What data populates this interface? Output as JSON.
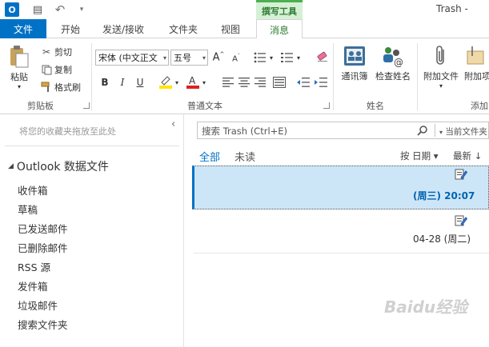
{
  "window": {
    "title": "Trash -",
    "context_tab_group": "撰写工具"
  },
  "tabs": [
    {
      "label": "文件"
    },
    {
      "label": "开始"
    },
    {
      "label": "发送/接收"
    },
    {
      "label": "文件夹"
    },
    {
      "label": "视图"
    },
    {
      "label": "消息"
    }
  ],
  "ribbon": {
    "clipboard": {
      "label": "剪贴板",
      "paste": "粘贴",
      "cut": "剪切",
      "copy": "复制",
      "format_painter": "格式刷"
    },
    "basic_text": {
      "label": "普通文本",
      "font": "宋体 (中文正文",
      "size": "五号"
    },
    "names": {
      "label": "姓名",
      "address_book": "通讯簿",
      "check_names": "检查姓名"
    },
    "include": {
      "label": "添加",
      "attach_file": "附加文件",
      "attach_item": "附加项"
    }
  },
  "left_pane": {
    "favorites_hint": "将您的收藏夹拖放至此处",
    "data_file": "Outlook 数据文件",
    "folders": [
      "收件箱",
      "草稿",
      "已发送邮件",
      "已删除邮件",
      "RSS 源",
      "发件箱",
      "垃圾邮件",
      "搜索文件夹"
    ]
  },
  "message_list": {
    "search_placeholder": "搜索 Trash (Ctrl+E)",
    "scope": "当前文件夹",
    "filter_all": "全部",
    "filter_unread": "未读",
    "sort_by": "按 日期 ▾",
    "sort_order": "最新 ↓",
    "items": [
      {
        "time": "(周三) 20:07",
        "selected": true
      },
      {
        "time": "04-28 (周二)",
        "selected": false
      }
    ]
  },
  "watermark": "Baidu经验",
  "colors": {
    "accent": "#0072c6",
    "selection": "#cde6f7",
    "context_tab": "#2e7d32"
  }
}
